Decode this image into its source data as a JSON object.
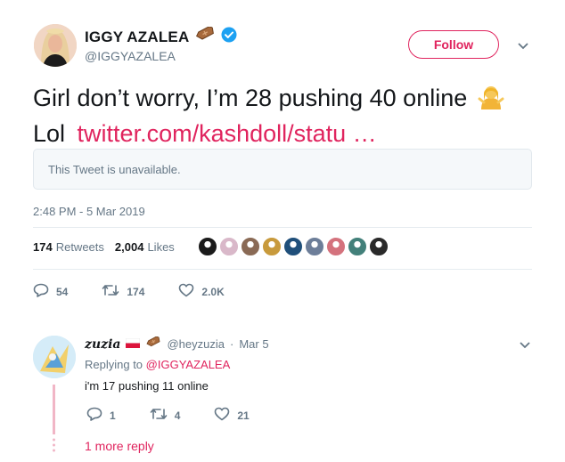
{
  "tweet": {
    "display_name": "IGGY AZALEA",
    "handle": "@IGGYAZALEA",
    "follow_label": "Follow",
    "text": "Girl don’t worry, I’m 28 pushing 40 online",
    "text_line2_prefix": "Lol",
    "link": "twitter.com/kashdoll/statu …",
    "quoted_unavailable": "This Tweet is unavailable.",
    "timestamp": "2:48 PM - 5 Mar 2019",
    "retweets_count": "174",
    "retweets_label": "Retweets",
    "likes_count": "2,004",
    "likes_label": "Likes",
    "actions": {
      "replies": "54",
      "retweets": "174",
      "likes": "2.0K"
    },
    "liker_colors": [
      "#1b1b1b",
      "#d9b8c9",
      "#8a6a55",
      "#c89a3c",
      "#1f4f7a",
      "#6d7e99",
      "#d4727d",
      "#43807a",
      "#2a2a2a"
    ]
  },
  "reply": {
    "display_name": "zuzia",
    "handle": "@heyzuzia",
    "separator": "·",
    "date": "Mar 5",
    "replying_prefix": "Replying to",
    "replying_to": "@IGGYAZALEA",
    "text": "i'm 17 pushing 11 online",
    "actions": {
      "replies": "1",
      "retweets": "4",
      "likes": "21"
    },
    "more_reply": "1 more reply"
  },
  "colors": {
    "accent": "#e0245e",
    "muted": "#657786",
    "verified": "#1da1f2",
    "text": "#14171a"
  }
}
